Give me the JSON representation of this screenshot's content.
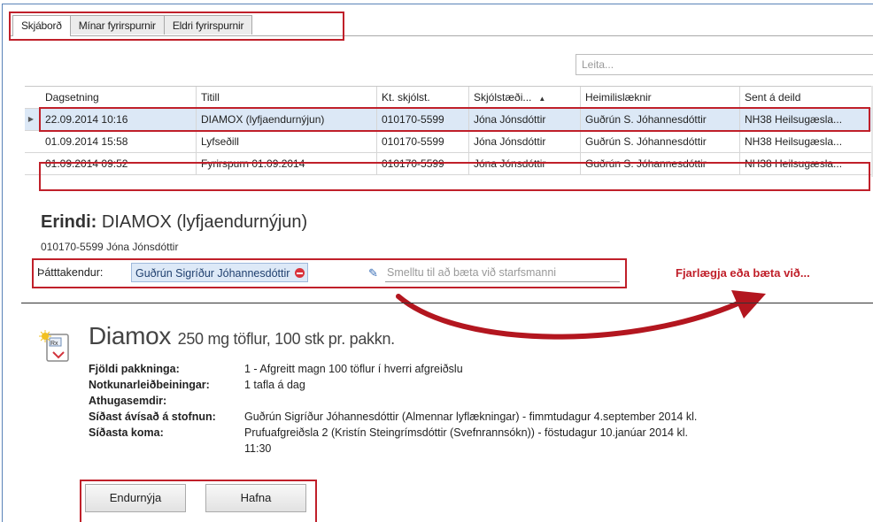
{
  "tabs": [
    "Skjáborð",
    "Mínar fyrirspurnir",
    "Eldri fyrirspurnir"
  ],
  "search": {
    "placeholder": "Leita..."
  },
  "grid": {
    "columns": [
      "Dagsetning",
      "Titill",
      "Kt. skjólst.",
      "Skjólstæði...",
      "Heimilislæknir",
      "Sent á deild"
    ],
    "rows": [
      [
        "22.09.2014 10:16",
        "DIAMOX (lyfjaendurnýjun)",
        "010170-5599",
        "Jóna Jónsdóttir",
        "Guðrún S. Jóhannesdóttir",
        "NH38 Heilsugæsla..."
      ],
      [
        "01.09.2014 15:58",
        "Lyfseðill",
        "010170-5599",
        "Jóna Jónsdóttir",
        "Guðrún S. Jóhannesdóttir",
        "NH38 Heilsugæsla..."
      ],
      [
        "01.09.2014 09:52",
        "Fyrirspurn 01.09.2014",
        "010170-5599",
        "Jóna Jónsdóttir",
        "Guðrún S. Jóhannesdóttir",
        "NH38 Heilsugæsla..."
      ]
    ]
  },
  "erindi": {
    "label": "Erindi:",
    "title": "DIAMOX (lyfjaendurnýjun)",
    "patient": "010170-5599 Jóna Jónsdóttir"
  },
  "participants": {
    "label": "Þátttakendur:",
    "token": "Guðrún Sigríður Jóhannesdóttir",
    "placeholder": "Smelltu til að bæta við starfsmanni"
  },
  "callout": "Fjarlægja eða bæta við...",
  "drug": {
    "name": "Diamox",
    "rest": "250 mg töflur, 100 stk pr. pakkn.",
    "details": [
      {
        "key": "Fjöldi pakkninga:",
        "value": "1 - Afgreitt magn 100 töflur í hverri afgreiðslu"
      },
      {
        "key": "Notkunarleiðbeiningar:",
        "value": "1 tafla á dag"
      },
      {
        "key": "Athugasemdir:",
        "value": ""
      },
      {
        "key": "Síðast ávísað á stofnun:",
        "value": "Guðrún Sigríður Jóhannesdóttir (Almennar lyflækningar) - fimmtudagur 4.september 2014 kl."
      },
      {
        "key": "Síðasta koma:",
        "value": "Prufuafgreiðsla 2 (Kristín Steingrímsdóttir (Svefnrannsókn)) - föstudagur 10.janúar 2014 kl."
      },
      {
        "key": "",
        "value": "11:30"
      }
    ]
  },
  "buttons": {
    "renew": "Endurnýja",
    "reject": "Hafna"
  },
  "colors": {
    "highlight": "#c0202a",
    "selection": "#dce8f6"
  }
}
